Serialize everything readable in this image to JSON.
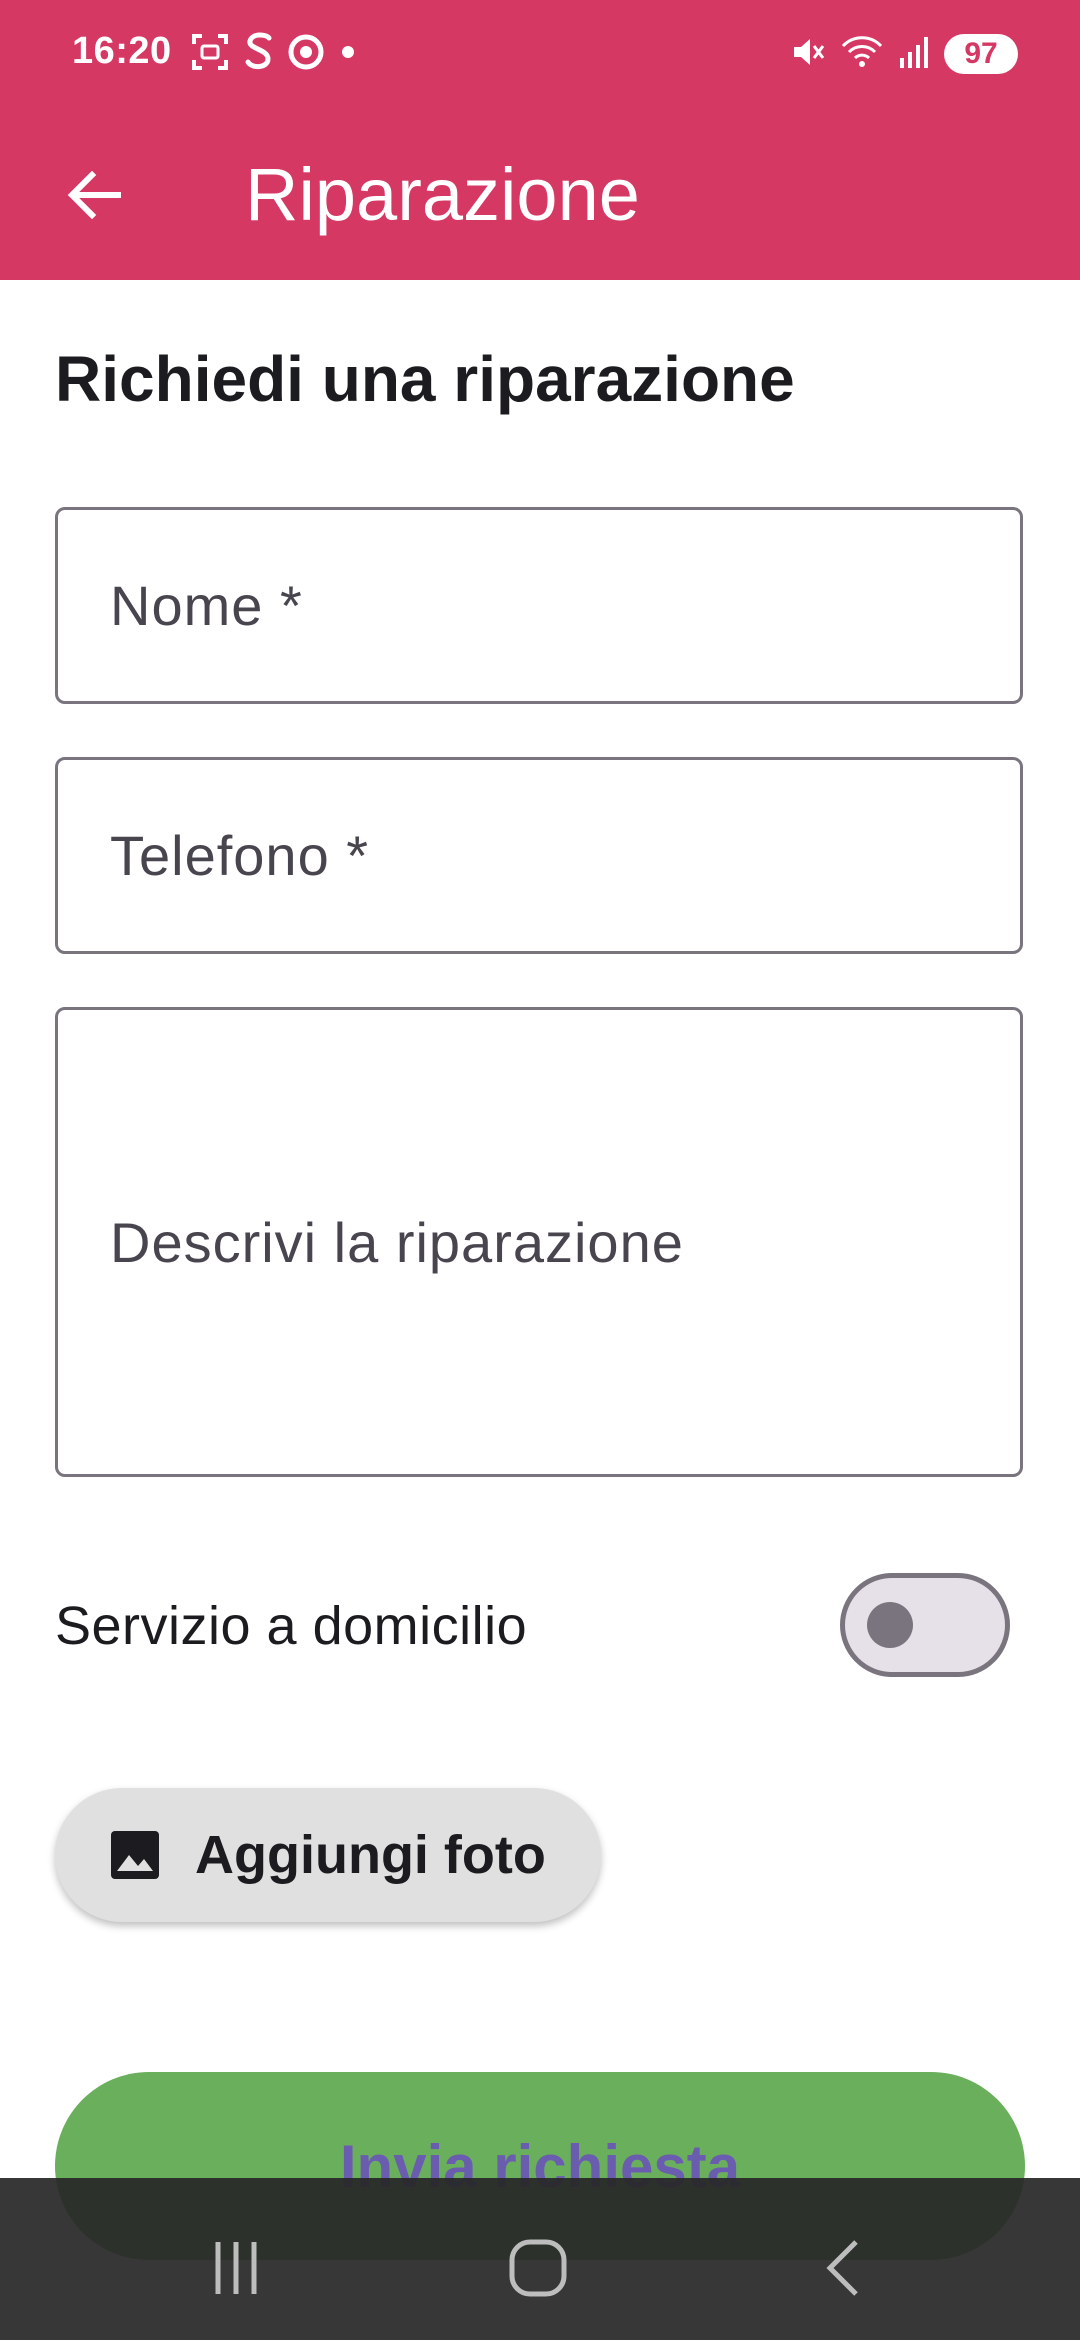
{
  "status_bar": {
    "time": "16:20",
    "left_icons": [
      "screenshot-icon",
      "s-app-icon",
      "chrome-icon",
      "dot-icon"
    ],
    "right_icons": [
      "mute-icon",
      "wifi-icon",
      "signal-icon"
    ],
    "battery": "97"
  },
  "app_bar": {
    "title": "Riparazione",
    "back_icon": "arrow-left-icon"
  },
  "form": {
    "heading": "Richiedi una riparazione",
    "name_placeholder": "Nome *",
    "phone_placeholder": "Telefono *",
    "description_placeholder": "Descrivi la riparazione",
    "home_service_label": "Servizio a domicilio",
    "home_service_enabled": false,
    "add_photo_label": "Aggiungi foto",
    "add_photo_icon": "image-icon",
    "submit_label": "Invia richiesta"
  },
  "nav_bar": {
    "icons": [
      "recent-apps-icon",
      "home-icon",
      "back-icon"
    ]
  },
  "colors": {
    "primary": "#d63864",
    "submit_bg": "#6aaf5c",
    "submit_text": "#6a5cae"
  }
}
